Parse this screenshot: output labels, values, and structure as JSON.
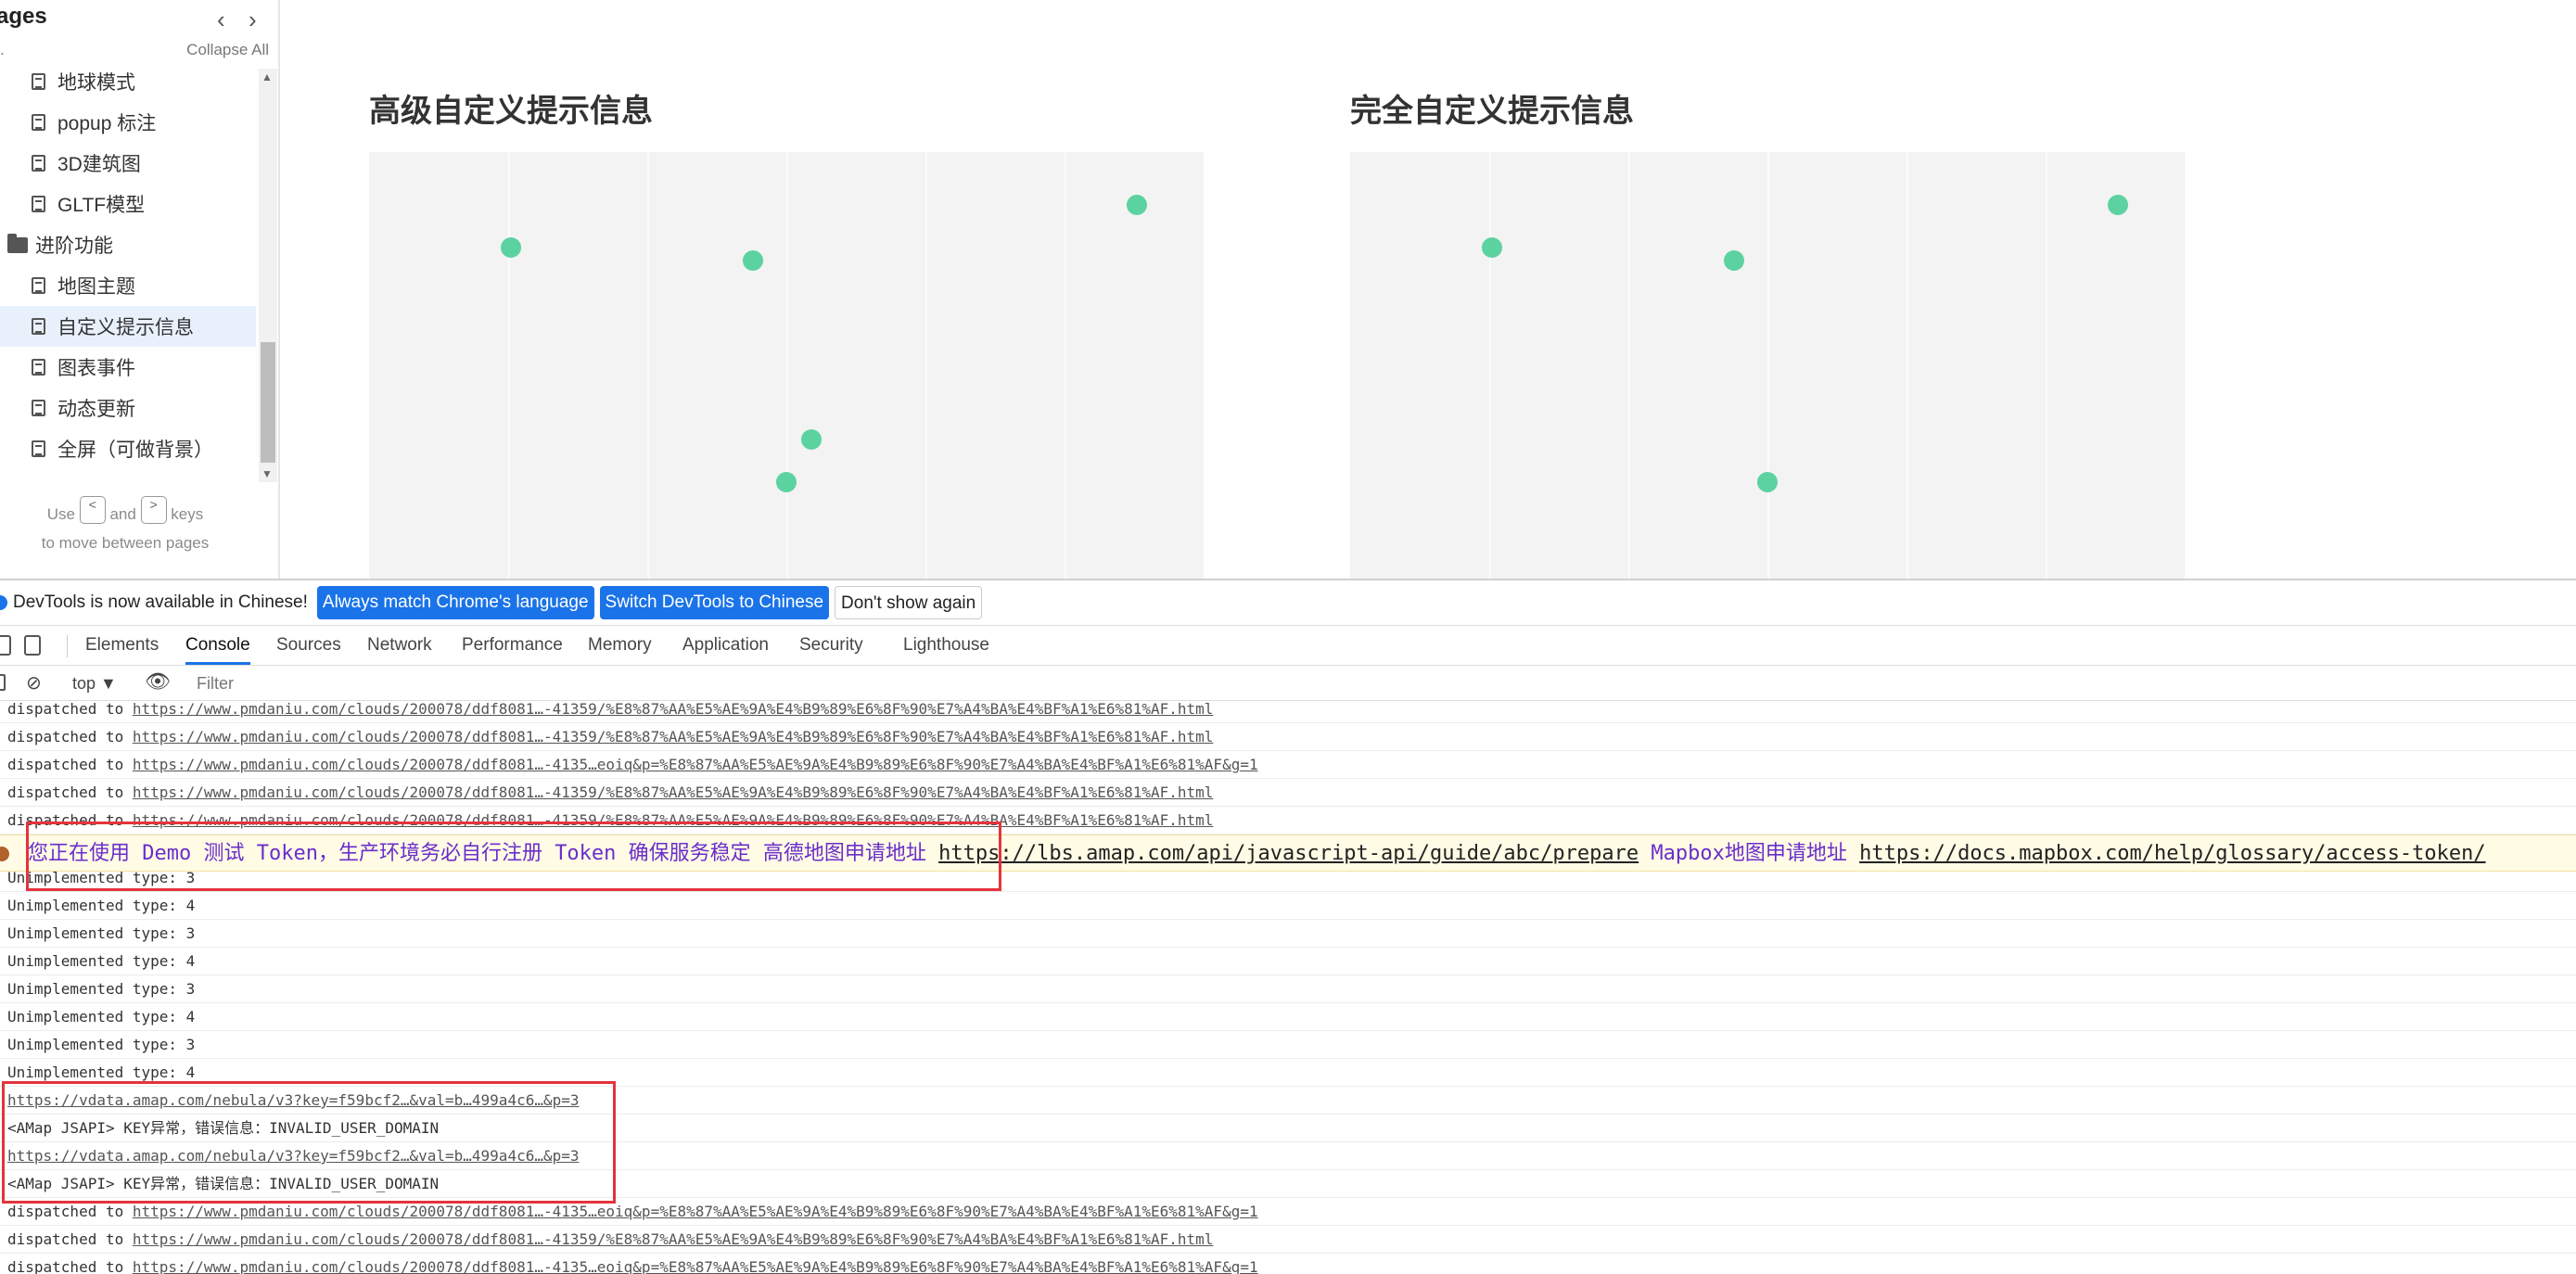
{
  "sidebar": {
    "title": "ages",
    "collapse_all": "Collapse All",
    "dot": ".",
    "items": [
      {
        "label": "地球模式",
        "kind": "doc",
        "active": false
      },
      {
        "label": "popup 标注",
        "kind": "doc",
        "active": false
      },
      {
        "label": "3D建筑图",
        "kind": "doc",
        "active": false
      },
      {
        "label": "GLTF模型",
        "kind": "doc",
        "active": false
      },
      {
        "label": "进阶功能",
        "kind": "folder",
        "active": false
      },
      {
        "label": "地图主题",
        "kind": "doc",
        "active": false
      },
      {
        "label": "自定义提示信息",
        "kind": "doc",
        "active": true
      },
      {
        "label": "图表事件",
        "kind": "doc",
        "active": false
      },
      {
        "label": "动态更新",
        "kind": "doc",
        "active": false
      },
      {
        "label": "全屏（可做背景）",
        "kind": "doc",
        "active": false
      }
    ],
    "hint": {
      "use": "Use",
      "key_prev": "<",
      "and": "and",
      "key_next": ">",
      "keys": "keys",
      "line2": "to move between pages"
    }
  },
  "panels": [
    {
      "title": "高级自定义提示信息"
    },
    {
      "title": "完全自定义提示信息"
    }
  ],
  "chart_data": [
    {
      "type": "scatter",
      "title": "高级自定义提示信息",
      "color": "#5cd2a0",
      "points": [
        {
          "x": 0.17,
          "y": 0.82
        },
        {
          "x": 0.46,
          "y": 0.79
        },
        {
          "x": 0.92,
          "y": 0.92
        },
        {
          "x": 0.53,
          "y": 0.37
        },
        {
          "x": 0.5,
          "y": 0.27
        }
      ]
    },
    {
      "type": "scatter",
      "title": "完全自定义提示信息",
      "color": "#5cd2a0",
      "points": [
        {
          "x": 0.17,
          "y": 0.82
        },
        {
          "x": 0.46,
          "y": 0.79
        },
        {
          "x": 0.92,
          "y": 0.92
        },
        {
          "x": 0.5,
          "y": 0.27
        }
      ]
    }
  ],
  "devtools": {
    "notice": {
      "text": "DevTools is now available in Chinese!",
      "btn_match": "Always match Chrome's language",
      "btn_switch": "Switch DevTools to Chinese",
      "btn_dismiss": "Don't show again"
    },
    "tabs": [
      "Elements",
      "Console",
      "Sources",
      "Network",
      "Performance",
      "Memory",
      "Application",
      "Security",
      "Lighthouse"
    ],
    "active_tab": "Console",
    "context": "top ▼",
    "filter_placeholder": "Filter",
    "console_rows": [
      {
        "prefix": "dispatched to ",
        "link": "https://www.pmdaniu.com/clouds/200078/ddf8081…-41359/%E8%87%AA%E5%AE%9A%E4%B9%89%E6%8F%90%E7%A4%BA%E4%BF%A1%E6%81%AF.html"
      },
      {
        "prefix": "dispatched to ",
        "link": "https://www.pmdaniu.com/clouds/200078/ddf8081…-41359/%E8%87%AA%E5%AE%9A%E4%B9%89%E6%8F%90%E7%A4%BA%E4%BF%A1%E6%81%AF.html"
      },
      {
        "prefix": "dispatched to ",
        "link": "https://www.pmdaniu.com/clouds/200078/ddf8081…-4135…eoiq&p=%E8%87%AA%E5%AE%9A%E4%B9%89%E6%8F%90%E7%A4%BA%E4%BF%A1%E6%81%AF&g=1"
      },
      {
        "prefix": "dispatched to ",
        "link": "https://www.pmdaniu.com/clouds/200078/ddf8081…-41359/%E8%87%AA%E5%AE%9A%E4%B9%89%E6%8F%90%E7%A4%BA%E4%BF%A1%E6%81%AF.html"
      },
      {
        "prefix": "dispatched to ",
        "link": "https://www.pmdaniu.com/clouds/200078/ddf8081…-41359/%E8%87%AA%E5%AE%9A%E4%B9%89%E6%8F%90%E7%A4%BA%E4%BF%A1%E6%81%AF.html"
      }
    ],
    "warning": {
      "text": "您正在使用 Demo 测试 Token，生产环境务必自行注册 Token 确保服务稳定 高德地图申请地址 ",
      "link1": "https://lbs.amap.com/api/javascript-api/guide/abc/prepare",
      "mid": "  Mapbox地图申请地址 ",
      "link2": "https://docs.mapbox.com/help/glossary/access-token/"
    },
    "unimplemented": [
      "Unimplemented type: 3",
      "Unimplemented type: 4",
      "Unimplemented type: 3",
      "Unimplemented type: 4",
      "Unimplemented type: 3",
      "Unimplemented type: 4",
      "Unimplemented type: 3",
      "Unimplemented type: 4"
    ],
    "amap_rows": [
      {
        "link": "https://vdata.amap.com/nebula/v3?key=f59bcf2…&val=b…499a4c6…&p=3"
      },
      {
        "text": "<AMap JSAPI> KEY异常，错误信息：INVALID_USER_DOMAIN"
      },
      {
        "link": "https://vdata.amap.com/nebula/v3?key=f59bcf2…&val=b…499a4c6…&p=3"
      },
      {
        "text": "<AMap JSAPI> KEY异常，错误信息：INVALID_USER_DOMAIN"
      }
    ],
    "tail_rows": [
      {
        "prefix": "dispatched to ",
        "link": "https://www.pmdaniu.com/clouds/200078/ddf8081…-4135…eoiq&p=%E8%87%AA%E5%AE%9A%E4%B9%89%E6%8F%90%E7%A4%BA%E4%BF%A1%E6%81%AF&g=1"
      },
      {
        "prefix": "dispatched to ",
        "link": "https://www.pmdaniu.com/clouds/200078/ddf8081…-41359/%E8%87%AA%E5%AE%9A%E4%B9%89%E6%8F%90%E7%A4%BA%E4%BF%A1%E6%81%AF.html"
      },
      {
        "prefix": "dispatched to ",
        "link": "https://www.pmdaniu.com/clouds/200078/ddf8081…-4135…eoiq&p=%E8%87%AA%E5%AE%9A%E4%B9%89%E6%8F%90%E7%A4%BA%E4%BF%A1%E6%81%AF&g=1"
      }
    ]
  }
}
